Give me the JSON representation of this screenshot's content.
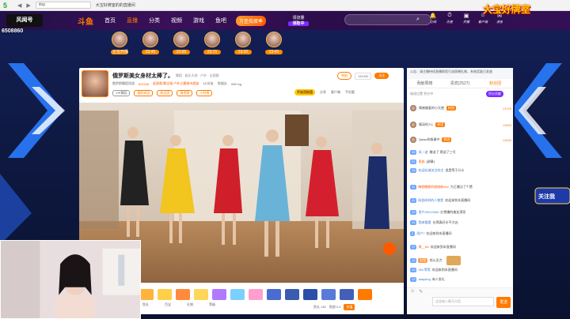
{
  "browser": {
    "logo": "5",
    "url": "dsg",
    "tab_title": "大宝好牌室的的直播间",
    "nav_back": "◀",
    "nav_forward": "▶"
  },
  "overlay": {
    "stream_id": "6508860",
    "brand_logo": "大宝好牌室"
  },
  "topnav": {
    "brand": "风闻号",
    "fish": "斗鱼",
    "items": [
      "首页",
      "直播",
      "分类",
      "视频",
      "游戏",
      "鱼吧"
    ],
    "promo": "万圣捣蛋季",
    "seek_line1": "领流量",
    "seek_line2": "领取中",
    "search_placeholder": "",
    "icons": [
      {
        "icon": "bell-icon",
        "label": "订阅"
      },
      {
        "icon": "history-icon",
        "label": "历史"
      },
      {
        "icon": "gift-icon",
        "label": "开播"
      },
      {
        "icon": "user-icon",
        "label": "客户端"
      },
      {
        "icon": "mail-icon",
        "label": "消息"
      }
    ]
  },
  "strip": {
    "items": [
      {
        "label": "正在开播"
      },
      {
        "label": "22:45"
      },
      {
        "label": "23:00"
      },
      {
        "label": "23:15"
      },
      {
        "label": "23:30"
      },
      {
        "label": "23:45"
      }
    ]
  },
  "room": {
    "title": "俄罗斯美女身材太棒了。",
    "category": "舞蹈 · 娱乐天地 · 户外 · 全国赛",
    "owner": "俄罗斯舞蹈用途",
    "hot": "621156",
    "rank_text": "起源赛/舞全服 户外之最城市超级",
    "stats": [
      "18 好友",
      "鱼翅丸",
      "999+kg"
    ],
    "tags": [
      "VIP舞蹈",
      "福利成员",
      "粉丝团",
      "周榜赛",
      "小时榜"
    ],
    "report": "举报",
    "follower_count": "131432",
    "follow": "关注",
    "tools": [
      "分享",
      "客户端",
      "手机看"
    ],
    "gold_badge": "开启活跃值"
  },
  "gifts": {
    "labels": [
      "鱼丸",
      "百宝",
      "礼物",
      "等级"
    ],
    "balance": "鱼丸 140",
    "coins": "鱼翅 0.4",
    "recharge": "充值"
  },
  "chat": {
    "notice": "公告：请主播持续直播帮您引流获赠礼物，系统奖励已发放",
    "tabs": [
      "贡献周榜",
      "贵宾(2527)",
      "粉丝团"
    ],
    "rank_head": "候选位置 积分中",
    "rank_button": "积分贡献",
    "ranking": [
      {
        "name": "情感偏爱的小天使",
        "badge": "粉团",
        "value": "13709"
      },
      {
        "name": "情深的人L",
        "badge": "粉团",
        "value": "12800"
      },
      {
        "name": "Qawu的故事中",
        "badge": "粉团",
        "value": "12600"
      }
    ],
    "messages": [
      {
        "lv": "15",
        "name": "风一波",
        "text": "赠送了 嗯送了三号"
      },
      {
        "lv": "21",
        "name": "贵族",
        "text": "[勋章]"
      },
      {
        "lv": "18",
        "name": "欢迎长城关注的主",
        "text": "说是等于什么"
      },
      {
        "lv": "11",
        "name": "俺就瞧都的刚刚新962",
        "text": "为王爆点了个赞"
      },
      {
        "lv": "11",
        "name": "网游体积的人物是",
        "text": "欢迎来到本直播间"
      },
      {
        "lv": "13",
        "name": "用户25219264",
        "text": "红雪播的美女漂亮"
      },
      {
        "lv": "14",
        "name": "我来看看",
        "text": "长得真好水平大凶"
      },
      {
        "lv": "2",
        "name": "用户7",
        "text": "欢迎来到本直播间"
      },
      {
        "lv": "17",
        "name": "周__Bb",
        "text": "欢迎来到本直播间"
      },
      {
        "lv": "12",
        "name": "红包",
        "text": "领火灵力"
      },
      {
        "lv": "15",
        "name": "ISA 等等",
        "text": "欢迎来到本直播间"
      },
      {
        "lv": "13",
        "name": "adapting",
        "text": "有人发礼"
      }
    ],
    "input_placeholder": "这里输入聊天内容",
    "send": "发送"
  },
  "side": {
    "follow_badge": "关注我"
  },
  "colors": {
    "accent": "#ff7a00",
    "nav_bg": "#2a0d4a",
    "chat_link": "#3a7bd5"
  }
}
